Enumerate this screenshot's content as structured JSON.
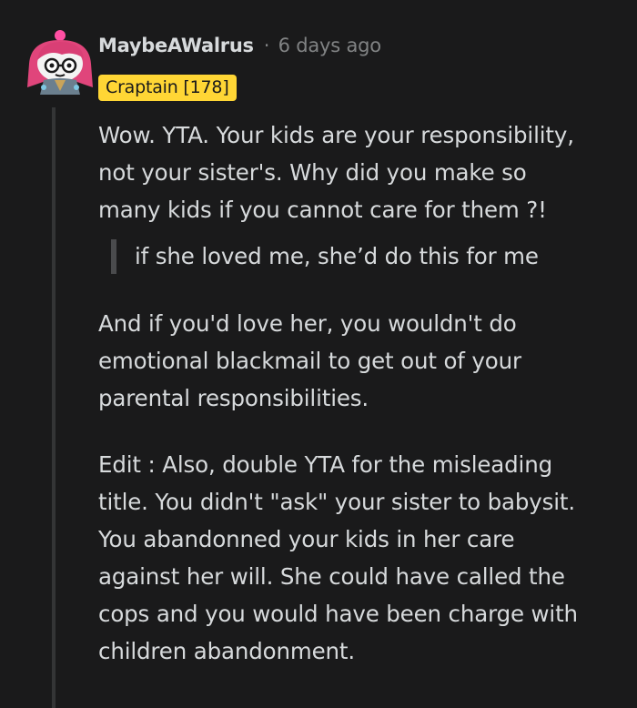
{
  "comment": {
    "username": "MaybeAWalrus",
    "separator": "·",
    "timestamp": "6 days ago",
    "flair": "Craptain [178]",
    "avatar_icon": "snoo-avatar-icon",
    "paragraph_1": "Wow. YTA. Your kids are your responsibility,\nnot your sister's. Why did you make so\nmany kids if you cannot care for them ?!",
    "quote": "if she loved me, she’d do this for me",
    "paragraph_2": "And if you'd love her, you wouldn't do\nemotional blackmail to get out of your\nparental responsibilities.",
    "paragraph_3": "Edit : Also, double YTA for the misleading\ntitle. You didn't \"ask\" your sister to babysit.\nYou abandonned your kids in her care\nagainst her will. She could have called the\ncops and you would have been charge with\nchildren abandonment."
  },
  "colors": {
    "background": "#1a1a1b",
    "text": "#d7dadc",
    "muted": "#818384",
    "flair_bg": "#ffd635",
    "thread_line": "#343536",
    "quote_bar": "#4a4b4d"
  }
}
